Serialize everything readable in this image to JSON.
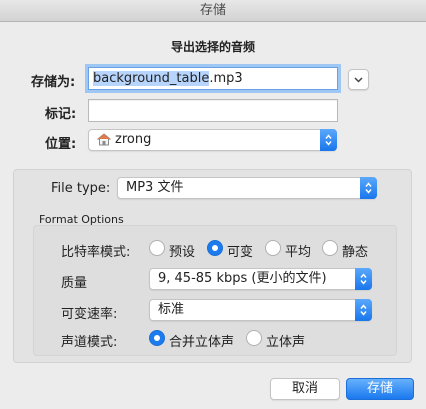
{
  "window": {
    "title": "存储"
  },
  "dialog": {
    "subtitle": "导出选择的音频"
  },
  "save_as": {
    "label": "存储为:",
    "filename_selected": "background_table",
    "filename_ext": ".mp3"
  },
  "tags": {
    "label": "标记:",
    "value": ""
  },
  "location": {
    "label": "位置:",
    "value": "zrong",
    "icon": "home-folder-icon"
  },
  "file_type": {
    "label": "File type:",
    "value": "MP3 文件"
  },
  "format_options": {
    "legend": "Format Options",
    "bitrate_mode": {
      "label": "比特率模式:",
      "options": [
        {
          "label": "预设",
          "selected": false
        },
        {
          "label": "可变",
          "selected": true
        },
        {
          "label": "平均",
          "selected": false
        },
        {
          "label": "静态",
          "selected": false
        }
      ]
    },
    "quality": {
      "label": "质量",
      "value": "9, 45-85 kbps (更小的文件)"
    },
    "variable_speed": {
      "label": "可变速率:",
      "value": "标准"
    },
    "channel_mode": {
      "label": "声道模式:",
      "options": [
        {
          "label": "合并立体声",
          "selected": true
        },
        {
          "label": "立体声",
          "selected": false
        }
      ]
    }
  },
  "buttons": {
    "cancel": "取消",
    "save": "存储"
  },
  "colors": {
    "accent": "#1d7bf0",
    "focus_ring": "#9ec7f3",
    "selection": "#b7d5fc"
  }
}
